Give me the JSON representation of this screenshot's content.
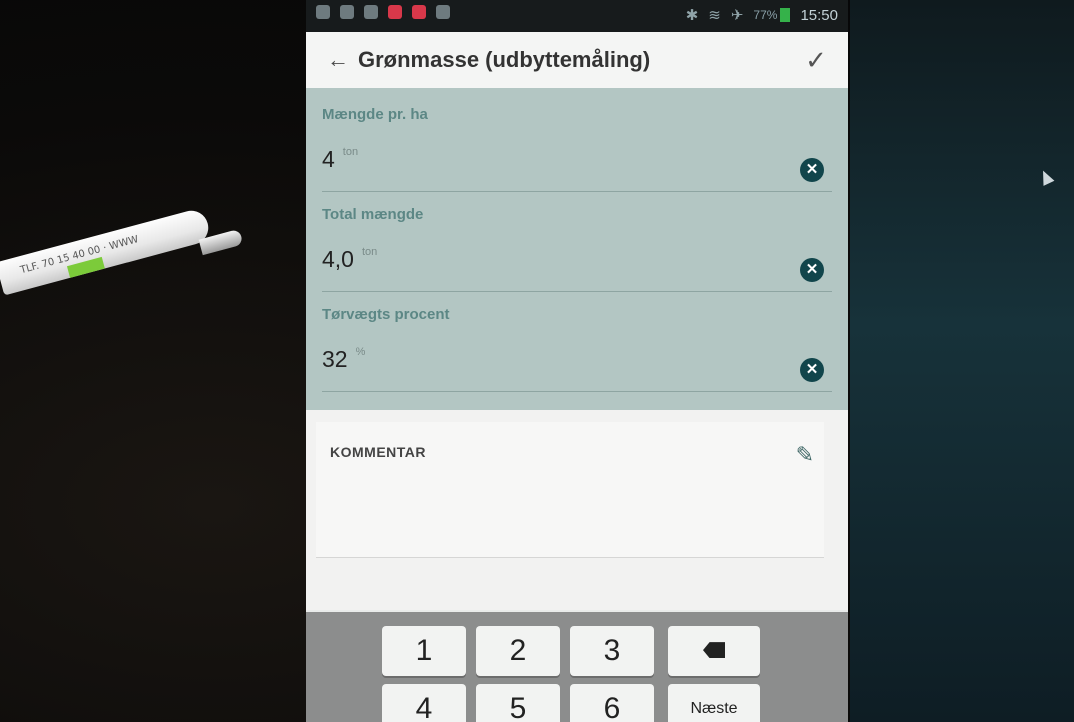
{
  "status": {
    "time": "15:50",
    "battery": "77%"
  },
  "appbar": {
    "title": "Grønmasse (udbyttemåling)"
  },
  "fields": [
    {
      "label": "Mængde pr. ha",
      "value": "4",
      "unit": "ton"
    },
    {
      "label": "Total mængde",
      "value": "4,0",
      "unit": "ton"
    },
    {
      "label": "Tørvægts procent",
      "value": "32",
      "unit": "%"
    }
  ],
  "comment": {
    "title": "KOMMENTAR"
  },
  "keyboard": {
    "keys": [
      "1",
      "2",
      "3",
      "4",
      "5",
      "6"
    ],
    "next": "Næste"
  },
  "pen": {
    "text": "TLF. 70 15 40 00 · WWW"
  },
  "colors": {
    "accent": "#11454b",
    "field_bg": "#b3c6c3",
    "label": "#5c8785"
  }
}
